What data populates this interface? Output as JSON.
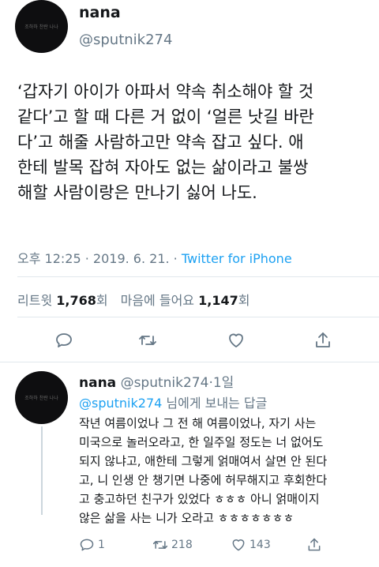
{
  "main_tweet": {
    "author_name": "nana",
    "author_handle": "@sputnik274",
    "avatar_text": "조하하 찬란 나나",
    "text_lines": [
      "‘갑자기 아이가 아파서 약속 취소해야 할 것",
      "같다’고 할 때 다른 거 없이 ‘얼른 낫길 바란",
      "다’고 해줄 사람하고만 약속 잡고 싶다. 애",
      "한테 발목 잡혀 자아도 없는 삶이라고 불쌍",
      "해할 사람이랑은 만나기 싫어 나도."
    ],
    "time": "오후 12:25",
    "separator": " · ",
    "date": "2019. 6. 21.",
    "source": "Twitter for iPhone",
    "retweets_label": "리트윗",
    "retweets_count": "1,768",
    "retweets_unit": "회",
    "likes_label": "마음에 들어요",
    "likes_count": "1,147",
    "likes_unit": "회",
    "actions": [
      "reply-icon",
      "retweet-icon",
      "like-icon",
      "share-icon"
    ]
  },
  "reply_tweet": {
    "author_name": "nana",
    "author_handle": "@sputnik274",
    "age": "·1일",
    "avatar_text": "조하하 찬란 나나",
    "replying_mention": "@sputnik274",
    "replying_suffix": " 님에게 보내는 답글",
    "text_lines": [
      "작년 여름이었나 그 전 해 여름이었나, 자기 사는",
      "미국으로 놀러오라고, 한 일주일 정도는 너 없어도",
      "되지 않냐고, 애한테 그렇게 얽매여서 살면 안 된다",
      "고, 니 인생 안 챙기면 나중에 허무해지고 후회한다",
      "고 충고하던 친구가 있었다 ㅎㅎㅎ 아니 얽매이지",
      "않은 삶을 사는 니가 오라고 ㅎㅎㅎㅎㅎㅎㅎ"
    ],
    "reply_count": "1",
    "retweet_count": "218",
    "like_count": "143"
  }
}
